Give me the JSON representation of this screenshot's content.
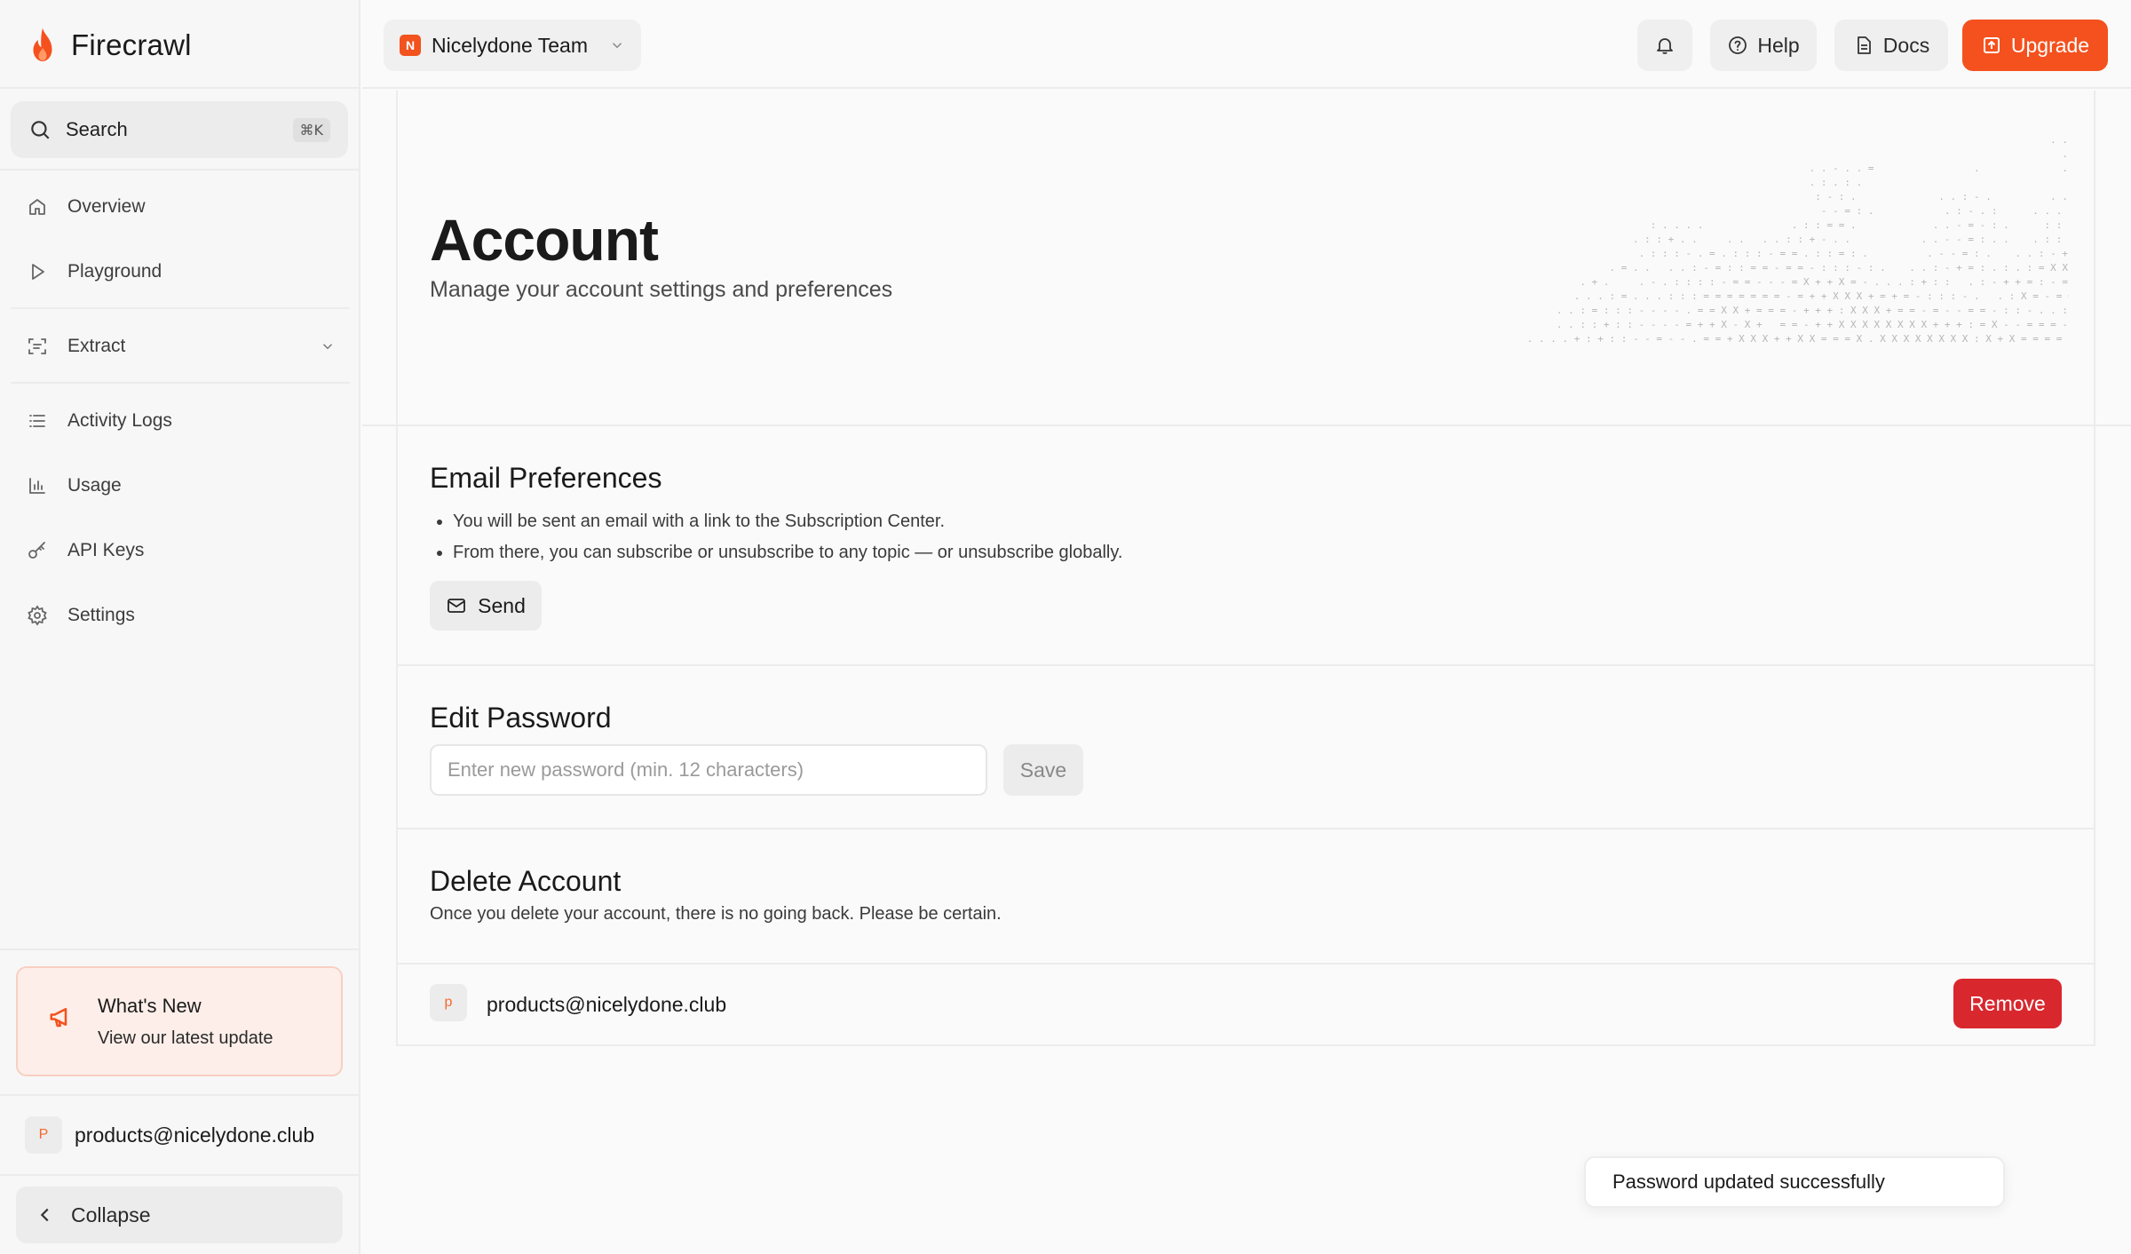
{
  "app": {
    "name": "Firecrawl"
  },
  "colors": {
    "brand": "#f4511e",
    "danger": "#d9272e"
  },
  "sidebar": {
    "search": {
      "label": "Search",
      "shortcut": "⌘K",
      "icon": "search-icon"
    },
    "items": [
      {
        "label": "Overview",
        "icon": "home-icon"
      },
      {
        "label": "Playground",
        "icon": "play-icon"
      },
      {
        "label": "Extract",
        "icon": "extract-icon",
        "expandable": true
      },
      {
        "label": "Activity Logs",
        "icon": "list-icon"
      },
      {
        "label": "Usage",
        "icon": "bar-chart-icon"
      },
      {
        "label": "API Keys",
        "icon": "key-icon"
      },
      {
        "label": "Settings",
        "icon": "gear-icon"
      }
    ],
    "whats_new": {
      "title": "What's New",
      "subtitle": "View our latest update"
    },
    "user": {
      "initial": "P",
      "email": "products@nicelydone.club"
    },
    "collapse_label": "Collapse"
  },
  "topbar": {
    "team": {
      "badge": "N",
      "name": "Nicelydone Team"
    },
    "help_label": "Help",
    "docs_label": "Docs",
    "upgrade_label": "Upgrade"
  },
  "page": {
    "title": "Account",
    "subtitle": "Manage your account settings and preferences"
  },
  "email_prefs": {
    "title": "Email Preferences",
    "bullets": [
      "You will be sent an email with a link to the Subscription Center.",
      "From there, you can subscribe or unsubscribe to any topic — or unsubscribe globally."
    ],
    "send_label": "Send"
  },
  "password": {
    "title": "Edit Password",
    "placeholder": "Enter new password (min. 12 characters)",
    "value": "",
    "save_label": "Save"
  },
  "delete_account": {
    "title": "Delete Account",
    "description": "Once you delete your account, there is no going back. Please be certain.",
    "member": {
      "initial": "p",
      "email": "products@nicelydone.club"
    },
    "remove_label": "Remove"
  },
  "toast": {
    "message": "Password updated successfully"
  }
}
